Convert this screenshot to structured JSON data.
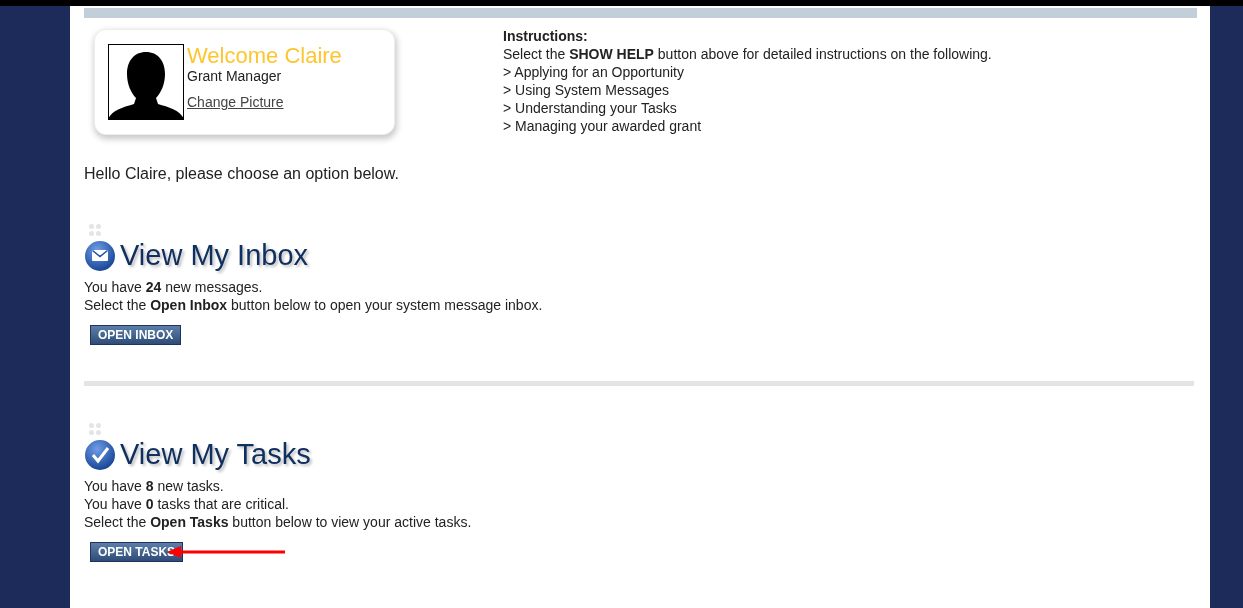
{
  "profile": {
    "greeting": "Welcome Claire",
    "role": "Grant Manager",
    "change_picture": "Change Picture"
  },
  "instructions": {
    "heading": "Instructions:",
    "intro": "Select the **SHOW HELP** button above for detailed instructions on the following.",
    "items": [
      "> Applying for an Opportunity",
      "> Using System Messages",
      "> Understanding your Tasks",
      "> Managing your awarded grant"
    ]
  },
  "hello": "Hello Claire, please choose an option below.",
  "sections": [
    {
      "kind": "inbox",
      "title": "View My Inbox",
      "lines": [
        "You have **24** new messages.",
        "Select the **Open Inbox** button below to open your system message inbox."
      ],
      "button": "OPEN INBOX",
      "pointer": false
    },
    {
      "kind": "tasks",
      "title": "View My Tasks",
      "lines": [
        "You have **8** new tasks.",
        "You have **0** tasks that are critical.",
        "Select the **Open Tasks** button below to view your active tasks."
      ],
      "button": "OPEN TASKS",
      "pointer": true
    }
  ]
}
